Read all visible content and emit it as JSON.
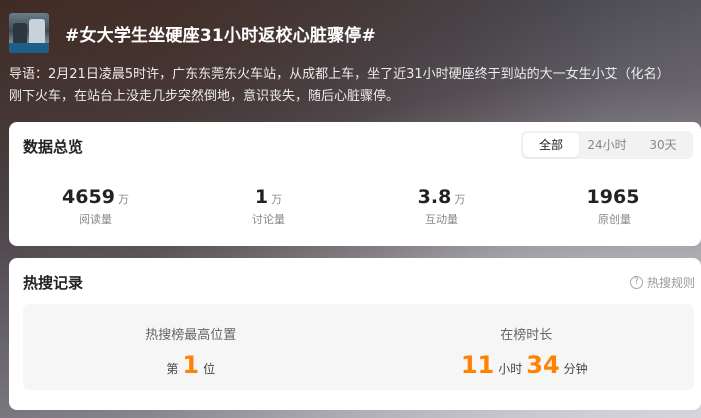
{
  "topic": {
    "title": "#女大学生坐硬座31小时返校心脏骤停#",
    "intro_line1": "导语：2月21日凌晨5时许，广东东莞东火车站，从成都上车，坐了近31小时硬座终于到站的大一女生小艾（化名）",
    "intro_line2": "刚下火车，在站台上没走几步突然倒地，意识丧失，随后心脏骤停。"
  },
  "overview": {
    "title": "数据总览",
    "tabs": [
      {
        "label": "全部",
        "active": true
      },
      {
        "label": "24小时",
        "active": false
      },
      {
        "label": "30天",
        "active": false
      }
    ],
    "stats": [
      {
        "value": "4659",
        "unit": "万",
        "label": "阅读量"
      },
      {
        "value": "1",
        "unit": "万",
        "label": "讨论量"
      },
      {
        "value": "3.8",
        "unit": "万",
        "label": "互动量"
      },
      {
        "value": "1965",
        "unit": "",
        "label": "原创量"
      }
    ]
  },
  "hot_search": {
    "title": "热搜记录",
    "rules_label": "热搜规则",
    "rules_icon": "question-icon",
    "highest": {
      "caption": "热搜榜最高位置",
      "prefix": "第",
      "value": "1",
      "suffix": "位"
    },
    "duration": {
      "caption": "在榜时长",
      "hours": "11",
      "hours_unit": "小时",
      "minutes": "34",
      "minutes_unit": "分钟"
    }
  },
  "colors": {
    "accent": "#ff8200"
  }
}
